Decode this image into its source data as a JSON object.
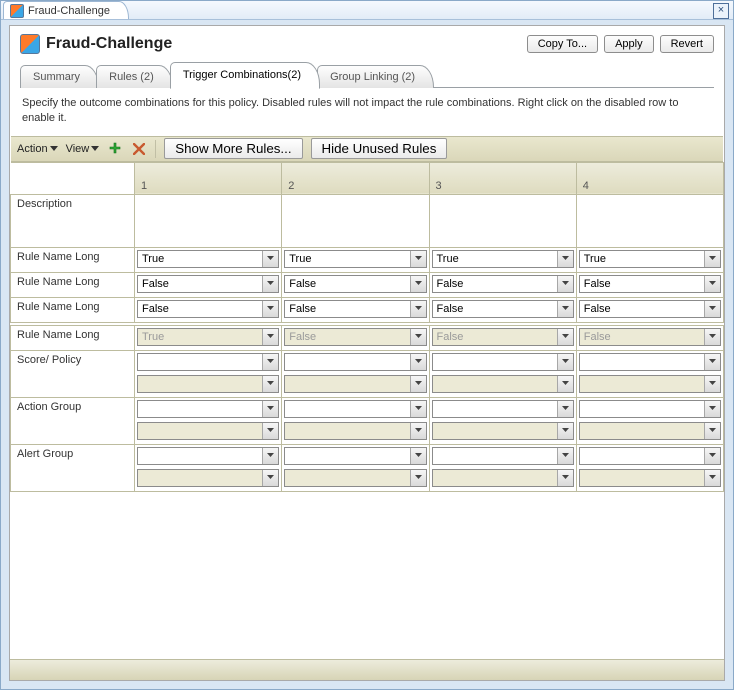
{
  "window": {
    "tab_title": "Fraud-Challenge",
    "close_label": "×"
  },
  "header": {
    "title": "Fraud-Challenge",
    "buttons": {
      "copy": "Copy To...",
      "apply": "Apply",
      "revert": "Revert"
    }
  },
  "tabs": {
    "summary": "Summary",
    "rules": "Rules (2)",
    "trigger": "Trigger Combinations(2)",
    "group": "Group Linking (2)"
  },
  "description": "Specify the outcome combinations for this policy. Disabled rules will not impact the rule combinations. Right click on the disabled row to enable it.",
  "toolbar": {
    "action": "Action",
    "view": "View",
    "show_more": "Show More Rules...",
    "hide_unused": "Hide Unused Rules"
  },
  "columns": [
    "1",
    "2",
    "3",
    "4"
  ],
  "rows": {
    "description": "Description",
    "rule1": "Rule Name Long",
    "rule2": "Rule Name Long",
    "rule3": "Rule Name Long",
    "rule4": "Rule Name Long",
    "score": "Score/ Policy",
    "action_group": "Action Group",
    "alert_group": "Alert Group"
  },
  "values": {
    "rule1": [
      "True",
      "True",
      "True",
      "True"
    ],
    "rule2": [
      "False",
      "False",
      "False",
      "False"
    ],
    "rule3": [
      "False",
      "False",
      "False",
      "False"
    ],
    "rule4": [
      "True",
      "False",
      "False",
      "False"
    ]
  }
}
